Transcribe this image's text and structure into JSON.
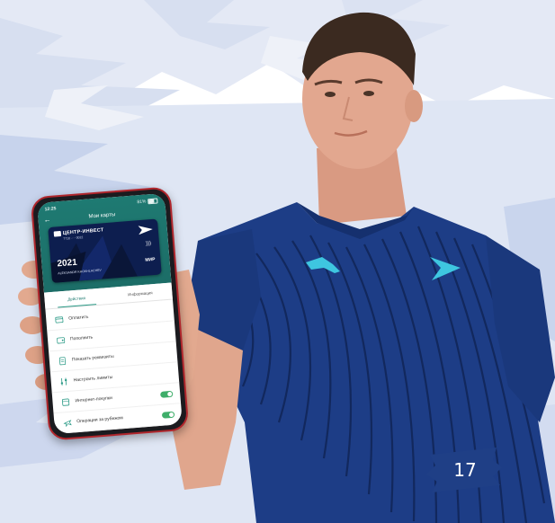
{
  "colors": {
    "background_sky": "#dde4f2",
    "brush_stroke": "#b6c5e6",
    "shirt": "#1d3d86",
    "shirt_stripes": "#0f2150",
    "skin": "#e2a78f",
    "hair": "#3b2a20",
    "phone_case": "#b0262c",
    "app_teal": "#1e7a72",
    "card_navy": "#0d1e4f",
    "toggle_green": "#3fae6a",
    "badge_blue": "#1f3f86"
  },
  "phone": {
    "status": {
      "time": "12:25",
      "battery": "81%"
    },
    "header_title": "Мои карты",
    "card": {
      "bank_name": "ЦЕНТР-ИНВЕСТ",
      "number_masked": "7710 ···· 0022",
      "year": "2021",
      "holder": "ALEKSANDR KHOKHLACHEV",
      "payment_system": "МИР"
    },
    "tabs": [
      {
        "label": "Действия",
        "active": true
      },
      {
        "label": "Информация",
        "active": false
      }
    ],
    "actions": [
      {
        "label": "Оплатить",
        "icon": "card-icon",
        "toggle": false
      },
      {
        "label": "Пополнить",
        "icon": "wallet-icon",
        "toggle": false
      },
      {
        "label": "Показать реквизиты",
        "icon": "document-icon",
        "toggle": false
      },
      {
        "label": "Настроить лимиты",
        "icon": "sliders-icon",
        "toggle": false
      },
      {
        "label": "Интернет-покупки",
        "icon": "cart-icon",
        "toggle": true
      },
      {
        "label": "Операции за рубежом",
        "icon": "plane-icon",
        "toggle": true
      }
    ]
  },
  "page_number": "17"
}
